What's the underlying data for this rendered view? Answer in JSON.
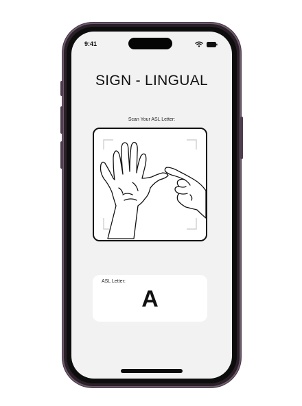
{
  "status_bar": {
    "time": "9:41",
    "icons": [
      "wifi-icon",
      "battery-icon"
    ]
  },
  "app": {
    "title": "SIGN - LINGUAL"
  },
  "scanner": {
    "prompt": "Scan Your ASL Letter:",
    "image": "hand-sign-illustration"
  },
  "result": {
    "label": "ASL Letter:",
    "value": "A"
  },
  "colors": {
    "phone_frame": "#6e5a6d",
    "screen_bg": "#f2f2f2",
    "card_bg": "#ffffff",
    "text": "#111111"
  }
}
